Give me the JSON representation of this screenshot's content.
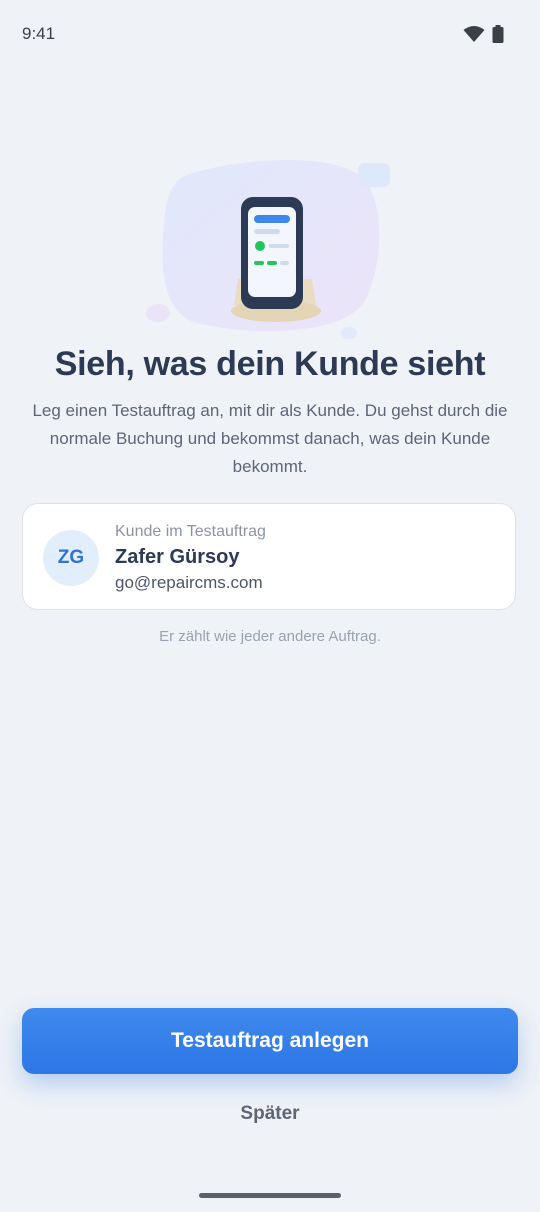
{
  "status_bar": {
    "time": "9:41",
    "icons": [
      "wifi-icon",
      "battery-icon"
    ]
  },
  "illustration": {
    "icon": "phone-illustration-icon"
  },
  "content": {
    "title": "Sieh, was dein Kunde sieht",
    "subtitle": "Leg einen Testauftrag an, mit dir als Kunde. Du gehst durch die normale Buchung und bekommst danach, was dein Kunde bekommt."
  },
  "customer_card": {
    "avatar_initials": "ZG",
    "label": "Kunde im Testauftrag",
    "name": "Zafer Gürsoy",
    "email": "go@repaircms.com"
  },
  "hint": "Er zählt wie jeder andere Auftrag.",
  "actions": {
    "primary_label": "Testauftrag anlegen",
    "secondary_label": "Später"
  },
  "colors": {
    "background": "#eff2f6",
    "primary": "#2f7ae6",
    "heading": "#2c3a55",
    "avatar_bg": "#e3eefc"
  }
}
